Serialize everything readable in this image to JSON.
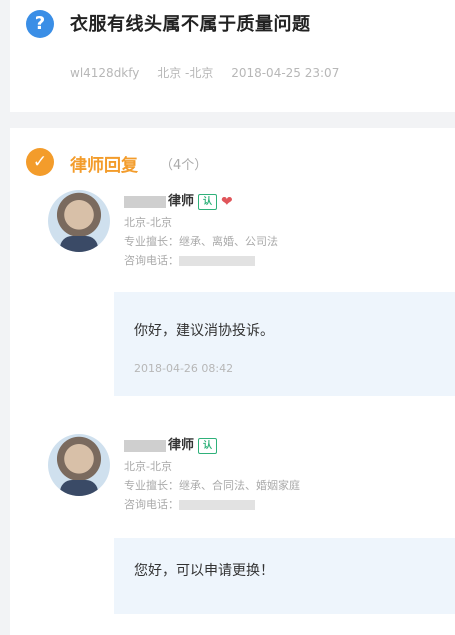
{
  "question": {
    "icon": "question-circle-icon",
    "icon_glyph": "?",
    "title": "衣服有线头属不属于质量问题",
    "user": "wl4128dkfy",
    "location": "北京 -北京",
    "datetime": "2018-04-25 23:07"
  },
  "answers": {
    "icon": "check-circle-icon",
    "icon_glyph": "✓",
    "title": "律师回复",
    "count": "（4个）",
    "items": [
      {
        "name": "律师",
        "location": "北京-北京",
        "specialty": "专业擅长：继承、离婚、公司法",
        "phone_label": "咨询电话：",
        "reply": "你好，建议消协投诉。",
        "time": "2018-04-26 08:42"
      },
      {
        "name": "律师",
        "location": "北京-北京",
        "specialty": "专业擅长：继承、合同法、婚姻家庭",
        "phone_label": "咨询电话：",
        "reply": "您好，可以申请更换！"
      }
    ]
  },
  "colors": {
    "accent_blue": "#3a8ee6",
    "accent_orange": "#f39c2b",
    "verify_green": "#2fb17a"
  }
}
